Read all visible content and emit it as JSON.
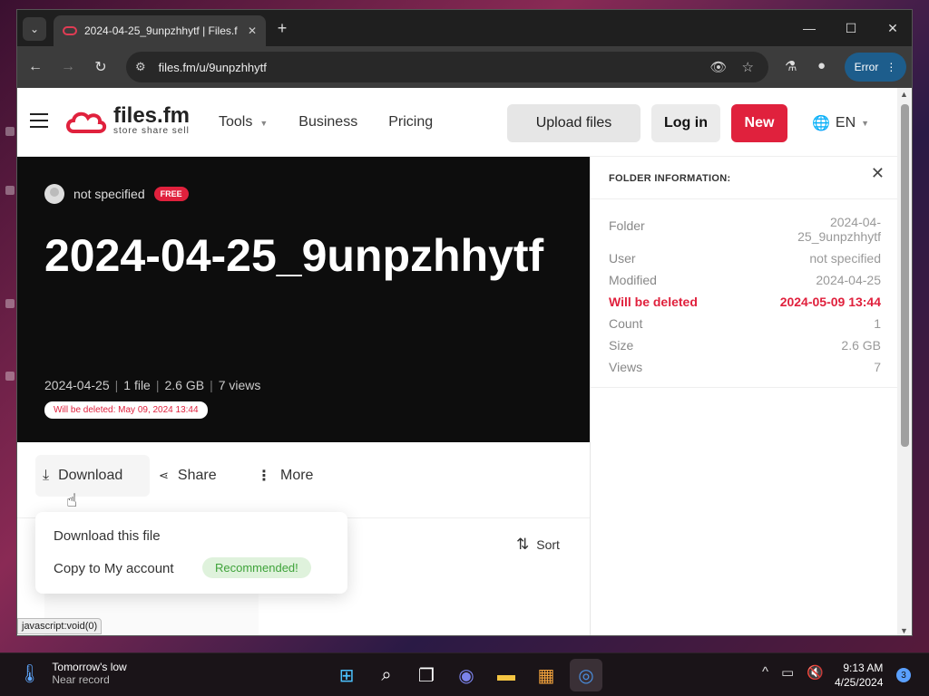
{
  "browser": {
    "tab_title": "2024-04-25_9unpzhhytf | Files.f",
    "url": "files.fm/u/9unpzhhytf",
    "error_label": "Error"
  },
  "header": {
    "logo_name": "files.fm",
    "logo_tagline": "store share sell",
    "nav": [
      "Tools",
      "Business",
      "Pricing"
    ],
    "upload_label": "Upload files",
    "login_label": "Log in",
    "new_label": "New",
    "language": "EN"
  },
  "hero": {
    "owner": "not specified",
    "badge": "FREE",
    "title": "2024-04-25_9unpzhhytf",
    "date": "2024-04-25",
    "files": "1 file",
    "size": "2.6 GB",
    "views": "7 views",
    "deletion_notice": "Will be deleted: May 09, 2024 13:44"
  },
  "actions": {
    "download": "Download",
    "share": "Share",
    "more": "More",
    "sort": "Sort"
  },
  "dropdown": {
    "download_file": "Download this file",
    "copy_account": "Copy to My account",
    "recommended": "Recommended!"
  },
  "status_bar": "javascript:void(0)",
  "panel": {
    "heading": "FOLDER INFORMATION:",
    "rows": [
      {
        "key": "Folder",
        "value": "2024-04-25_9unpzhhytf"
      },
      {
        "key": "User",
        "value": "not specified"
      },
      {
        "key": "Modified",
        "value": "2024-04-25"
      },
      {
        "key": "Will be deleted",
        "value": "2024-05-09 13:44"
      },
      {
        "key": "Count",
        "value": "1"
      },
      {
        "key": "Size",
        "value": "2.6 GB"
      },
      {
        "key": "Views",
        "value": "7"
      }
    ]
  },
  "taskbar": {
    "weather_title": "Tomorrow's low",
    "weather_sub": "Near record",
    "time": "9:13 AM",
    "date": "4/25/2024",
    "notifications": "3"
  },
  "colors": {
    "brand_red": "#e0213d",
    "hero_bg": "#0d0d0d",
    "accent_blue": "#1d5d8c"
  }
}
